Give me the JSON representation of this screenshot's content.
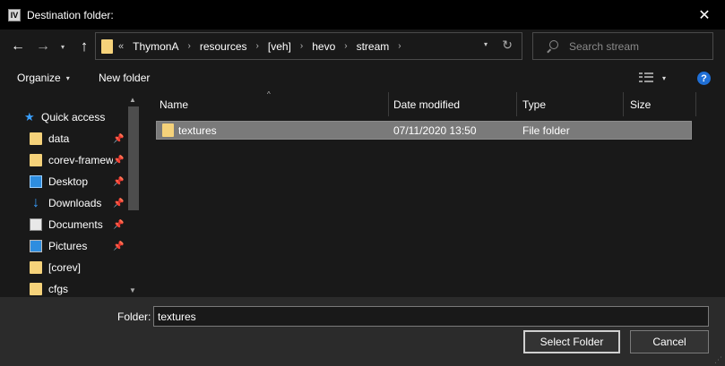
{
  "window": {
    "title": "Destination folder:",
    "app_icon_text": "IV",
    "close_glyph": "✕"
  },
  "nav": {
    "back_glyph": "←",
    "forward_glyph": "→",
    "dropdown_glyph": "▾",
    "up_glyph": "↑"
  },
  "address": {
    "overflow": "«",
    "crumbs": [
      "ThymonA",
      "resources",
      "[veh]",
      "hevo",
      "stream"
    ],
    "separator": "›",
    "dropdown_glyph": "▾",
    "refresh_glyph": "↻"
  },
  "search": {
    "placeholder": "Search stream"
  },
  "toolbar": {
    "organize_label": "Organize",
    "caret": "▾",
    "new_folder_label": "New folder",
    "help_glyph": "?"
  },
  "sidebar": {
    "items": [
      {
        "label": "Quick access",
        "icon": "star-icon",
        "pinned": false
      },
      {
        "label": "data",
        "icon": "folder-icon",
        "pinned": true
      },
      {
        "label": "corev-framew",
        "icon": "folder-icon",
        "pinned": true
      },
      {
        "label": "Desktop",
        "icon": "desktop-icon",
        "pinned": true
      },
      {
        "label": "Downloads",
        "icon": "download-icon",
        "pinned": true
      },
      {
        "label": "Documents",
        "icon": "documents-icon",
        "pinned": true
      },
      {
        "label": "Pictures",
        "icon": "pictures-icon",
        "pinned": true
      },
      {
        "label": "[corev]",
        "icon": "folder-icon",
        "pinned": false
      },
      {
        "label": "cfgs",
        "icon": "folder-icon",
        "pinned": false
      }
    ],
    "pin_glyph": "📌"
  },
  "files": {
    "columns": [
      "Name",
      "Date modified",
      "Type",
      "Size"
    ],
    "sort_glyph": "^",
    "rows": [
      {
        "name": "textures",
        "date": "07/11/2020 13:50",
        "type": "File folder",
        "size": ""
      }
    ]
  },
  "footer": {
    "folder_label": "Folder:",
    "folder_value": "textures",
    "select_label": "Select Folder",
    "cancel_label": "Cancel"
  },
  "colors": {
    "background": "#191919",
    "titlebar": "#000000",
    "footer": "#2b2b2b",
    "selection": "#7a7a7a",
    "accent": "#3aa0ff",
    "folder": "#f5d27a"
  }
}
